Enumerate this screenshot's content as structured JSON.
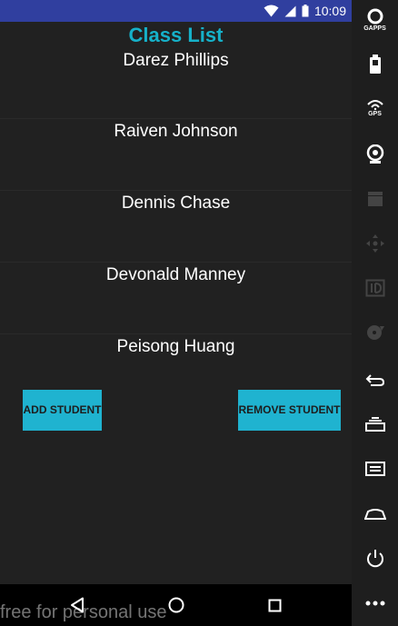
{
  "status_bar": {
    "time": "10:09"
  },
  "title": "Class List",
  "students": [
    {
      "name": "Darez Phillips"
    },
    {
      "name": "Raiven Johnson"
    },
    {
      "name": "Dennis Chase"
    },
    {
      "name": "Devonald Manney"
    },
    {
      "name": "Peisong Huang"
    }
  ],
  "buttons": {
    "add": "ADD STUDENT",
    "remove": "REMOVE STUDENT"
  },
  "watermark": "free for personal use",
  "emulator_panel": {
    "gapps_label": "GAPPS",
    "gps_label": "GPS"
  },
  "colors": {
    "status_bar": "#303f9f",
    "accent": "#16b1c9",
    "button": "#1fb3d0",
    "background": "#212121"
  }
}
